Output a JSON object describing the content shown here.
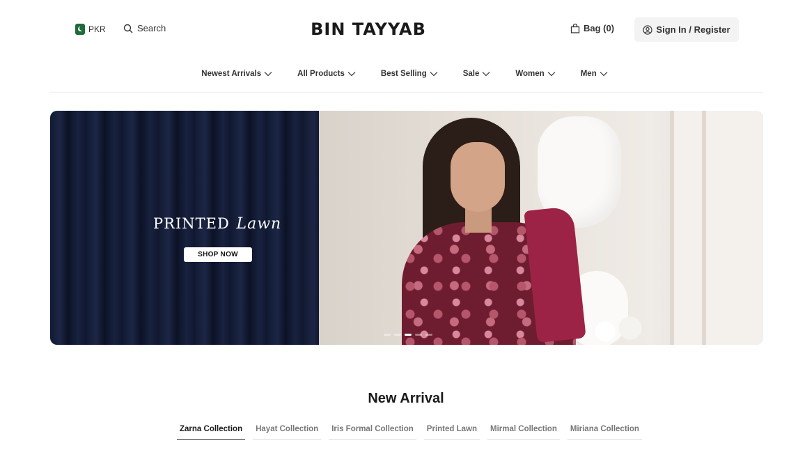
{
  "header": {
    "currency": "PKR",
    "search_label": "Search",
    "logo": "BIN TAYYAB",
    "bag_label": "Bag (0)",
    "signin_label": "Sign In / Register"
  },
  "nav": {
    "items": [
      {
        "label": "Newest Arrivals"
      },
      {
        "label": "All Products"
      },
      {
        "label": "Best Selling"
      },
      {
        "label": "Sale"
      },
      {
        "label": "Women"
      },
      {
        "label": "Men"
      }
    ]
  },
  "hero": {
    "title_main": "PRINTED",
    "title_script": "Lawn",
    "cta_label": "SHOP NOW",
    "slide_count": 5,
    "active_slide": 3
  },
  "new_arrival": {
    "title": "New Arrival",
    "tabs": [
      {
        "label": "Zarna Collection",
        "active": true
      },
      {
        "label": "Hayat Collection",
        "active": false
      },
      {
        "label": "Iris Formal Collection",
        "active": false
      },
      {
        "label": "Printed Lawn",
        "active": false
      },
      {
        "label": "Mirmal Collection",
        "active": false
      },
      {
        "label": "Miriana Collection",
        "active": false
      }
    ]
  },
  "colors": {
    "accent_dark": "#1a1a1a",
    "flag_green": "#1f6b3a",
    "button_bg": "#f3f3f3"
  }
}
